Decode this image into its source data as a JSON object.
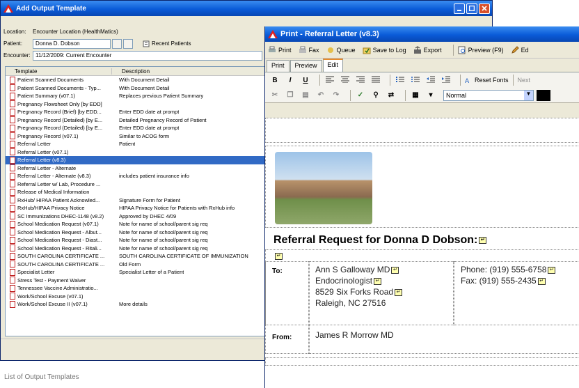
{
  "win1": {
    "title": "Add Output Template",
    "location_label": "Location:",
    "location_value": "Encounter Location (HealthMatics)",
    "patient_label": "Patient:",
    "patient_value": "Donna D. Dobson",
    "recent_label": "Recent Patients",
    "encounter_label": "Encounter:",
    "encounter_value": "11/12/2009: Current Encounter",
    "col_template": "Template",
    "col_description": "Description",
    "rows": [
      {
        "t": "Patient Scanned Documents",
        "d": "With Document Detail"
      },
      {
        "t": "Patient Scanned Documents - Typ...",
        "d": "With Document Detail"
      },
      {
        "t": "Patient Summary (v07.1)",
        "d": "Replaces previous Patient Summary"
      },
      {
        "t": "Pregnancy Flowsheet Only [by EDD]",
        "d": ""
      },
      {
        "t": "Pregnancy Record (Brief) [by EDD...",
        "d": "Enter EDD date at prompt"
      },
      {
        "t": "Pregnancy Record (Detailed) [by E...",
        "d": "Detailed Pregnancy Record of Patient"
      },
      {
        "t": "Pregnancy Record (Detailed) [by E...",
        "d": "Enter EDD date at prompt"
      },
      {
        "t": "Pregnancy Record (v07.1)",
        "d": "Similar to ACOG form"
      },
      {
        "t": "Referral Letter",
        "d": "Patient"
      },
      {
        "t": "Referral Letter (v07.1)",
        "d": ""
      },
      {
        "t": "Referral Letter (v8.3)",
        "d": ""
      },
      {
        "t": "Referral Letter - Alternate",
        "d": ""
      },
      {
        "t": "Referral Letter - Alternate (v8.3)",
        "d": "includes patient insurance info"
      },
      {
        "t": "Referral Letter w/ Lab, Procedure ...",
        "d": ""
      },
      {
        "t": "Release of Medical Information",
        "d": ""
      },
      {
        "t": "RxHub/ HIPAA Patient Acknowled...",
        "d": "Signature Form for Patient"
      },
      {
        "t": "RxHub/HIPAA Privacy Notice",
        "d": "HIPAA Privacy Notice for Patients with RxHub info"
      },
      {
        "t": "SC Immunizations DHEC-1148 (v8.2)",
        "d": "Approved by DHEC 4/09"
      },
      {
        "t": "School Medication Request (v07.1)",
        "d": "Note for name of school/parent sig req"
      },
      {
        "t": "School Medication Request - Albut...",
        "d": "Note for name of school/parent sig req"
      },
      {
        "t": "School Medication Request - Diast...",
        "d": "Note for name of school/parent sig req"
      },
      {
        "t": "School Medication Request - Ritali...",
        "d": "Note for name of school/parent sig req"
      },
      {
        "t": "SOUTH CAROLINA CERTIFICATE ...",
        "d": "SOUTH CAROLINA CERTIFICATE OF IMMUNIZATION"
      },
      {
        "t": "SOUTH CAROLINA CERTIFICATE ...",
        "d": "Old Form"
      },
      {
        "t": "Specialist Letter",
        "d": "Specialist Letter of a Patient"
      },
      {
        "t": "Stress Test - Payment Waiver",
        "d": ""
      },
      {
        "t": "Tennessee Vaccine Administratio...",
        "d": ""
      },
      {
        "t": "Work/School Excuse (v07.1)",
        "d": ""
      },
      {
        "t": "Work/School Excuse II (v07.1)",
        "d": "More details"
      }
    ],
    "selected_index": 10
  },
  "caption": "List of Output Templates",
  "win2": {
    "title": "Print - Referral Letter (v8.3)",
    "toolbar": [
      "Print",
      "Fax",
      "Queue",
      "Save to Log",
      "Export",
      "Preview (F9)",
      "Ed"
    ],
    "tabs": [
      "Print",
      "Preview",
      "Edit"
    ],
    "active_tab": "Edit",
    "format_bold": "B",
    "format_italic": "I",
    "format_underline": "U",
    "reset_fonts": "Reset Fonts",
    "next": "Next",
    "style_value": "Normal",
    "doc": {
      "heading": "Referral Request for Donna D Dobson:",
      "to_label": "To:",
      "to_lines": [
        "Ann S Galloway MD",
        "Endocrinologist",
        "8529 Six Forks Road",
        "Raleigh, NC 27516"
      ],
      "phone": "Phone: (919) 555-6758",
      "fax": "Fax: (919) 555-2435",
      "from_label": "From:",
      "from_value": "James R Morrow MD"
    }
  },
  "colors": {
    "titlebar": "#0a5bd8",
    "selection": "#316ac5",
    "tab_accent": "#e68b2c"
  }
}
